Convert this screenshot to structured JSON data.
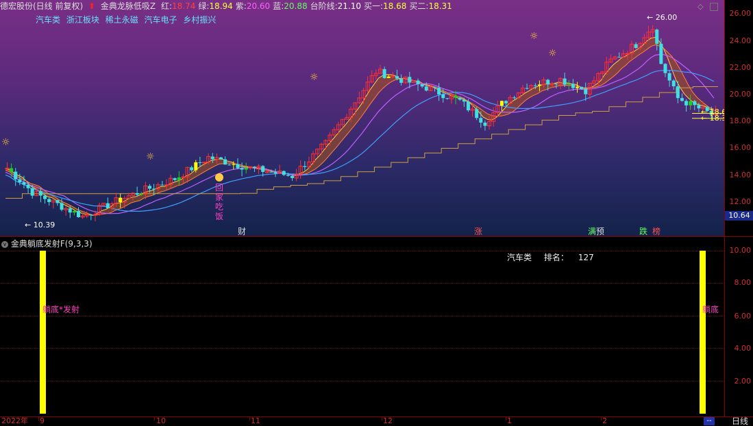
{
  "header": {
    "stock_name": "德宏股份(日线 前复权)",
    "indicator_name": "金典龙脉低吸Z",
    "values": [
      {
        "label": "红:",
        "value": "18.74",
        "color": "#ff4040"
      },
      {
        "label": "绿:",
        "value": "18.94",
        "color": "#ffff40"
      },
      {
        "label": "紫:",
        "value": "20.60",
        "color": "#ff60ff"
      },
      {
        "label": "蓝:",
        "value": "20.88",
        "color": "#60ff60"
      },
      {
        "label": "台阶线:",
        "value": "21.10",
        "color": "#ffffff"
      },
      {
        "label": "买一:",
        "value": "18.68",
        "color": "#ffff40"
      },
      {
        "label": "买二:",
        "value": "18.31",
        "color": "#ffff40"
      }
    ]
  },
  "sectors": [
    "汽车类",
    "浙江板块",
    "稀土永磁",
    "汽车电子",
    "乡村振兴"
  ],
  "main_y_axis": [
    "26.00",
    "24.00",
    "22.00",
    "20.00",
    "18.00",
    "16.00",
    "14.00",
    "12.00"
  ],
  "current_price_tag": "10.64",
  "annotations": {
    "high_label": "26.00",
    "low_label": "10.39",
    "buy1_tag": "18.68",
    "buy2_tag": "18.31",
    "home_dinner": "回家吃饭"
  },
  "events": [
    {
      "text": "财",
      "color": "#dddddd"
    },
    {
      "text": "涨",
      "color": "#ff5050"
    },
    {
      "text": "预",
      "color": "#dddddd"
    },
    {
      "text": "跌",
      "color": "#60ff60"
    },
    {
      "text": "榜",
      "color": "#ff5050"
    }
  ],
  "sub_panel": {
    "title": "金典躺底发射F(9,3,3)",
    "y_axis": [
      "10.00",
      "8.00",
      "6.00",
      "4.00",
      "2.00"
    ],
    "sector": "汽车类",
    "rank_label": "排名：",
    "rank_value": "127",
    "signal_left": "躺底*发射",
    "signal_right": "躺底"
  },
  "date_axis": [
    "2022年",
    "9",
    "10",
    "11",
    "12",
    "1",
    "2"
  ],
  "period": "日线",
  "period_ellipsis": "--"
}
